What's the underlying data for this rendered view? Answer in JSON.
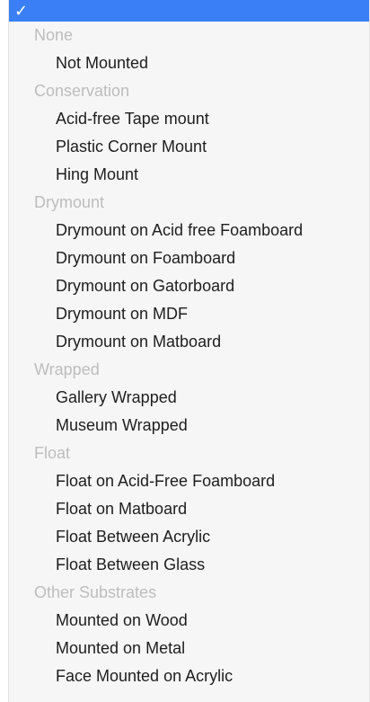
{
  "selected_row": {
    "check": "✓",
    "label": ""
  },
  "groups": [
    {
      "header": "None",
      "options": [
        "Not Mounted"
      ]
    },
    {
      "header": "Conservation",
      "options": [
        "Acid-free Tape mount",
        "Plastic Corner Mount",
        "Hing Mount"
      ]
    },
    {
      "header": "Drymount",
      "options": [
        "Drymount on Acid free Foamboard",
        "Drymount on Foamboard",
        "Drymount on Gatorboard",
        "Drymount on MDF",
        "Drymount on Matboard"
      ]
    },
    {
      "header": "Wrapped",
      "options": [
        "Gallery Wrapped",
        "Museum Wrapped"
      ]
    },
    {
      "header": "Float",
      "options": [
        "Float on Acid-Free Foamboard",
        "Float on Matboard",
        "Float Between Acrylic",
        "Float Between Glass"
      ]
    },
    {
      "header": "Other Substrates",
      "options": [
        "Mounted on Wood",
        "Mounted on Metal",
        "Face Mounted on Acrylic"
      ]
    }
  ],
  "colors": {
    "selection": "#3a7ff5",
    "header_text": "#bdbdbd",
    "option_text": "#1e1e1e",
    "menu_bg": "#f6f6f6"
  }
}
